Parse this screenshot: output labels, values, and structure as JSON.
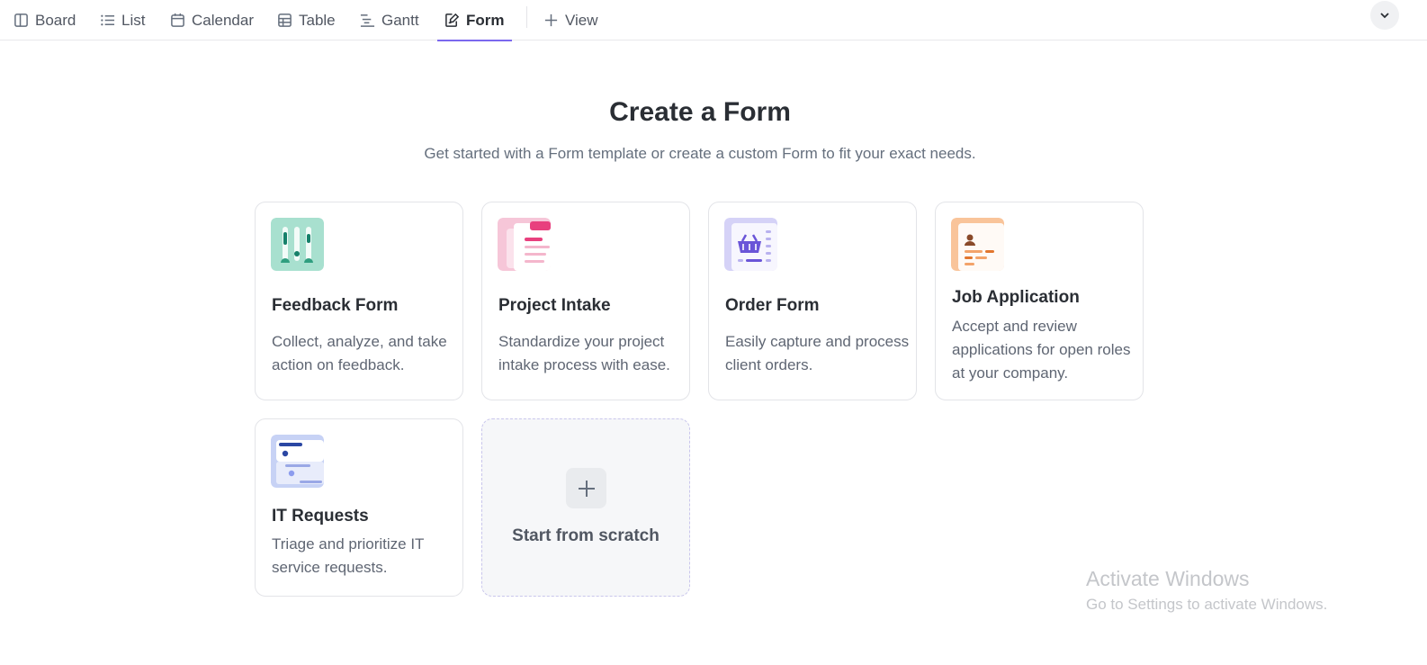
{
  "tabs": [
    {
      "label": "Board",
      "icon": "board-icon"
    },
    {
      "label": "List",
      "icon": "list-icon"
    },
    {
      "label": "Calendar",
      "icon": "calendar-icon"
    },
    {
      "label": "Table",
      "icon": "table-icon"
    },
    {
      "label": "Gantt",
      "icon": "gantt-icon"
    },
    {
      "label": "Form",
      "icon": "form-icon",
      "active": true
    }
  ],
  "add_view_label": "View",
  "header": {
    "title": "Create a Form",
    "subtitle": "Get started with a Form template or create a custom Form to fit your exact needs."
  },
  "templates": [
    {
      "title": "Feedback Form",
      "desc": "Collect, analyze, and take action on feedback.",
      "icon": "feedback-form-icon",
      "accent": "#a8e0cf"
    },
    {
      "title": "Project Intake",
      "desc": "Standardize your project intake process with ease.",
      "icon": "project-intake-icon",
      "accent": "#f6c6d8"
    },
    {
      "title": "Order Form",
      "desc": "Easily capture and process client orders.",
      "icon": "order-basket-icon",
      "accent": "#d5d2f7"
    },
    {
      "title": "Job Application",
      "desc": "Accept and review applications for open roles at your company.",
      "icon": "job-application-icon",
      "accent": "#f9c49a"
    },
    {
      "title": "IT Requests",
      "desc": "Triage and prioritize IT service requests.",
      "icon": "it-requests-icon",
      "accent": "#c7d2f5"
    }
  ],
  "scratch": {
    "label": "Start from scratch"
  },
  "watermark": {
    "title": "Activate Windows",
    "subtitle": "Go to Settings to activate Windows."
  },
  "colors": {
    "accent": "#7b68ee",
    "text": "#2a2e34",
    "muted": "#656f7d"
  }
}
